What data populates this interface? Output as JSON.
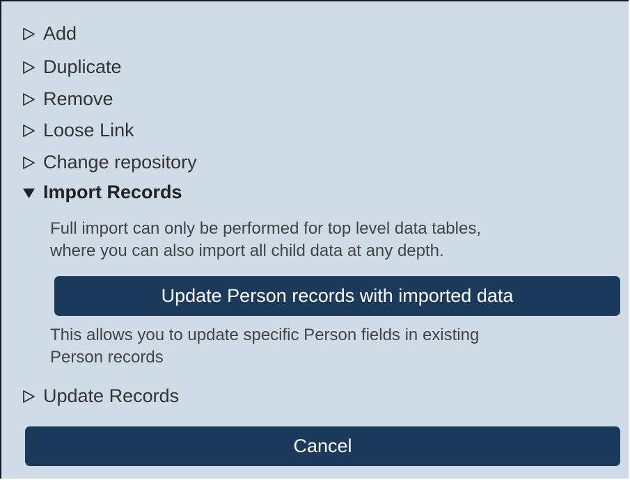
{
  "menu": {
    "items": [
      {
        "label": "Add",
        "icon": "collapsed-triangle-icon"
      },
      {
        "label": "Duplicate",
        "icon": "collapsed-triangle-icon"
      },
      {
        "label": "Remove",
        "icon": "collapsed-triangle-icon"
      },
      {
        "label": "Loose Link",
        "icon": "collapsed-triangle-icon"
      },
      {
        "label": "Change repository",
        "icon": "collapsed-triangle-icon"
      }
    ],
    "expanded": {
      "label": "Import Records",
      "icon": "expanded-triangle-icon",
      "description_line1": "Full import can only be performed for top level data tables,",
      "description_line2": "where you can also import all child data at any depth.",
      "action_button": "Update Person records with imported data",
      "action_description_line1": "This allows you to update specific Person fields in existing",
      "action_description_line2": "Person records"
    },
    "after": {
      "label": "Update Records",
      "icon": "collapsed-triangle-icon"
    }
  },
  "cancel_label": "Cancel",
  "colors": {
    "background": "#cfdbe6",
    "button": "#1c3b5c",
    "button_text": "#ffffff",
    "text": "#333333"
  }
}
